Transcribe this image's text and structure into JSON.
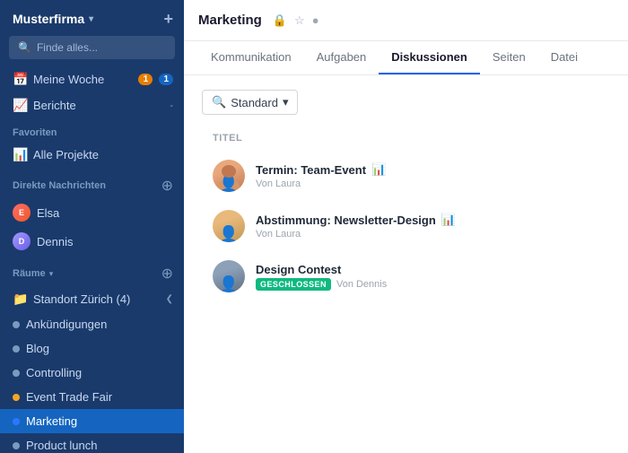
{
  "sidebar": {
    "company": "Musterfirma",
    "search_placeholder": "Finde alles...",
    "my_week": "Meine Woche",
    "reports": "Berichte",
    "reports_badge": "-",
    "favorites_label": "Favoriten",
    "all_projects": "Alle Projekte",
    "dm_label": "Direkte Nachrichten",
    "dm_elsa": "Elsa",
    "dm_dennis": "Dennis",
    "rooms_label": "Räume",
    "rooms": [
      {
        "name": "Standort Zürich (4)",
        "dot": "folder",
        "active": false
      },
      {
        "name": "Ankündigungen",
        "dot": "gray",
        "active": false
      },
      {
        "name": "Blog",
        "dot": "gray",
        "active": false
      },
      {
        "name": "Controlling",
        "dot": "gray",
        "active": false
      },
      {
        "name": "Event Trade Fair",
        "dot": "yellow",
        "active": false
      },
      {
        "name": "Marketing",
        "dot": "blue",
        "active": true
      },
      {
        "name": "Product lunch",
        "dot": "gray",
        "active": false
      }
    ],
    "week_badge_orange": "1",
    "week_badge_blue": "1"
  },
  "main": {
    "title": "Marketing",
    "tabs": [
      {
        "label": "Kommunikation",
        "active": false
      },
      {
        "label": "Aufgaben",
        "active": false
      },
      {
        "label": "Diskussionen",
        "active": true
      },
      {
        "label": "Seiten",
        "active": false
      },
      {
        "label": "Datei",
        "active": false
      }
    ],
    "filter": {
      "icon": "🔍",
      "label": "Standard",
      "chevron": "▾"
    },
    "table_header": "TITEL",
    "discussions": [
      {
        "title": "Termin: Team-Event",
        "meta": "Von Laura",
        "has_chart": true,
        "avatar_class": "portrait-1",
        "closed": false
      },
      {
        "title": "Abstimmung: Newsletter-Design",
        "meta": "Von Laura",
        "has_chart": true,
        "avatar_class": "portrait-1",
        "closed": false
      },
      {
        "title": "Design Contest",
        "meta": "Von Dennis",
        "has_chart": false,
        "avatar_class": "portrait-3",
        "closed": true,
        "closed_label": "GESCHLOSSEN"
      }
    ]
  },
  "icons": {
    "lock": "🔒",
    "star": "☆",
    "dot_menu": "●",
    "chart_bar": "📊",
    "search": "🔍",
    "chevron_down": "▾",
    "chevron_right": "❯",
    "plus": "+",
    "folder": "📁",
    "minus": "−"
  }
}
